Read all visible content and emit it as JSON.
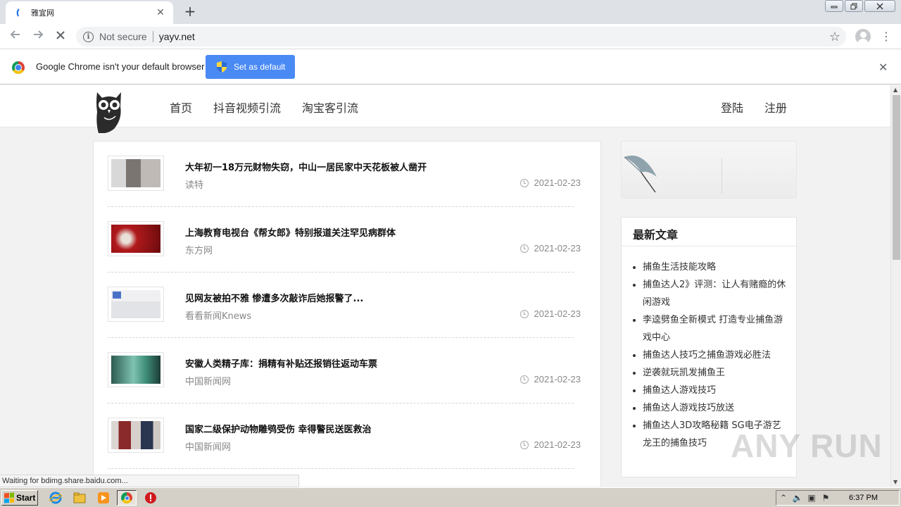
{
  "browser": {
    "tab_title": "雅宜网",
    "tab_close": "✕",
    "new_tab": "+",
    "security_label": "Not secure",
    "url": "yayv.net",
    "window_buttons": [
      "▭",
      "❐",
      "✕"
    ]
  },
  "infobar": {
    "message": "Google Chrome isn't your default browser",
    "button_label": "Set as default",
    "close": "✕"
  },
  "site": {
    "nav": [
      "首页",
      "抖音视频引流",
      "淘宝客引流"
    ],
    "login": "登陆",
    "register": "注册"
  },
  "articles": [
    {
      "title": "大年初一18万元财物失窃，中山一居民家中天花板被人凿开",
      "source": "读特",
      "date": "2021-02-23",
      "thumb_color": "#6e6a66"
    },
    {
      "title": "上海教育电视台《帮女郎》特别报道关注罕见病群体",
      "source": "东方网",
      "date": "2021-02-23",
      "thumb_color": "#b0191c"
    },
    {
      "title": "见网友被拍不雅 惨遭多次敲诈后她报警了...",
      "source": "看看新闻Knews",
      "date": "2021-02-23",
      "thumb_color": "#e8e8ea"
    },
    {
      "title": "安徽人类精子库：捐精有补贴还报销往返动车票",
      "source": "中国新闻网",
      "date": "2021-02-23",
      "thumb_color": "#3f8f7a"
    },
    {
      "title": "国家二级保护动物雕鸮受伤 幸得警民送医救治",
      "source": "中国新闻网",
      "date": "2021-02-23",
      "thumb_color": "#8d6a5a"
    }
  ],
  "sidebar": {
    "title": "最新文章",
    "items": [
      "捕鱼生活技能攻略",
      "捕鱼达人2》评测：让人有赌瘾的休闲游戏",
      "李逵劈鱼全新模式 打造专业捕鱼游戏中心",
      "捕鱼达人技巧之捕鱼游戏必胜法",
      "逆袭就玩凯发捕鱼王",
      "捕鱼达人游戏技巧",
      "捕鱼达人游戏技巧放送",
      "捕鱼达人3D攻略秘籍 SG电子游艺龙王的捕鱼技巧"
    ]
  },
  "status": "Waiting for bdimg.share.baidu.com...",
  "watermark": "ANY RUN",
  "taskbar": {
    "start": "Start",
    "time": "6:37 PM"
  },
  "colors": {
    "accent": "#4a8af4",
    "page_bg": "#f2f2f2",
    "tab_strip": "#dee1e6"
  }
}
